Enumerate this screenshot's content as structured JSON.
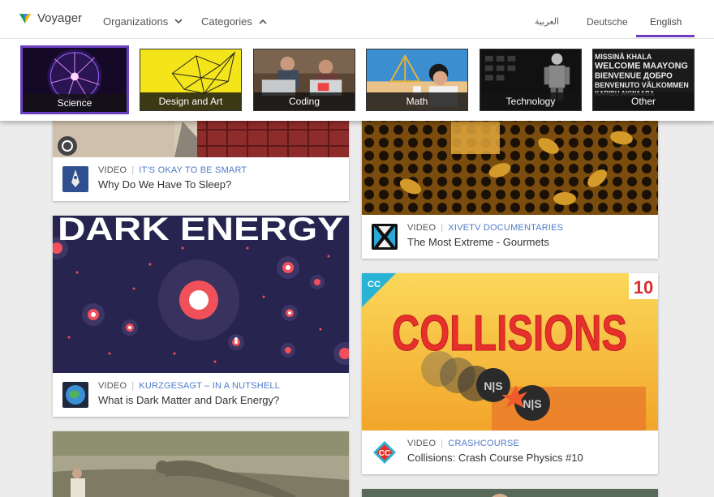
{
  "header": {
    "app_name": "Voyager",
    "nav": [
      {
        "label": "Organizations",
        "chevron": "chevron-down-icon"
      },
      {
        "label": "Categories",
        "chevron": "chevron-up-icon"
      }
    ],
    "languages": [
      "العربية",
      "Deutsche",
      "English"
    ],
    "active_language": "English",
    "accent_color": "#6a3fc1"
  },
  "categories": [
    {
      "label": "Science",
      "selected": true
    },
    {
      "label": "Design and Art",
      "selected": false
    },
    {
      "label": "Coding",
      "selected": false
    },
    {
      "label": "Math",
      "selected": false
    },
    {
      "label": "Technology",
      "selected": false
    },
    {
      "label": "Other",
      "selected": false
    }
  ],
  "cards": [
    {
      "type": "VIDEO",
      "source": "IT'S OKAY TO BE SMART",
      "title": "Why Do We Have To Sleep?"
    },
    {
      "type": "VIDEO",
      "source": "XIVETV DOCUMENTARIES",
      "title": "The Most Extreme - Gourmets"
    },
    {
      "type": "VIDEO",
      "source": "KURZGESAGT – IN A NUTSHELL",
      "title": "What is Dark Matter and Dark Energy?",
      "thumb_text": "DARK ENERGY"
    },
    {
      "type": "VIDEO",
      "source": "CRASHCOURSE",
      "title": "Collisions: Crash Course Physics #10",
      "thumb_text": "COLLISIONS",
      "badge": "10",
      "cc_label": "CC"
    }
  ]
}
